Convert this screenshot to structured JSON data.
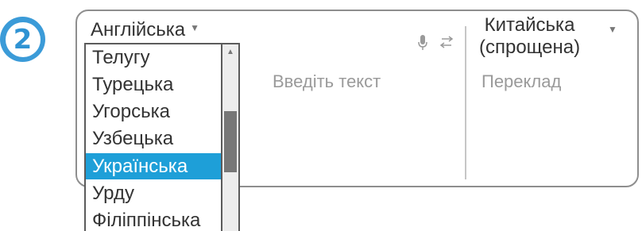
{
  "step_badge": {
    "number": "2"
  },
  "translator": {
    "source_language": "Англійська",
    "input_placeholder": "Введіть текст",
    "target_language_line1": "Китайська",
    "target_language_line2": "(спрощена)",
    "output_placeholder": "Переклад"
  },
  "dropdown": {
    "items": [
      "Телугу",
      "Турецька",
      "Угорська",
      "Узбецька",
      "Українська",
      "Урду",
      "Філіппінська"
    ],
    "selected": "Українська"
  },
  "icons": [
    "microphone-icon",
    "swap-languages-icon",
    "caret-down-icon",
    "scroll-up-arrow-icon"
  ],
  "colors": {
    "badge": "#3b9bd8",
    "selected_item": "#1e9fd8",
    "border": "#8e8e8e"
  }
}
